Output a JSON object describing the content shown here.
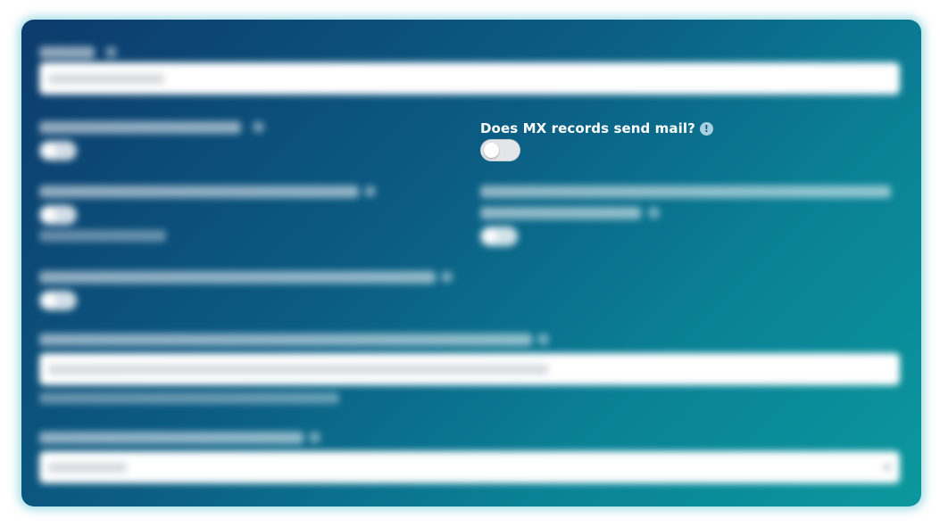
{
  "form": {
    "mx_send_mail": {
      "label": "Does MX records send mail?",
      "info_icon": "info-icon",
      "info_glyph": "!",
      "enabled": false
    }
  },
  "colors": {
    "card_gradient_start": "#0c3b6c",
    "card_gradient_end": "#0b989d",
    "toggle_off": "#e3e5e8"
  }
}
